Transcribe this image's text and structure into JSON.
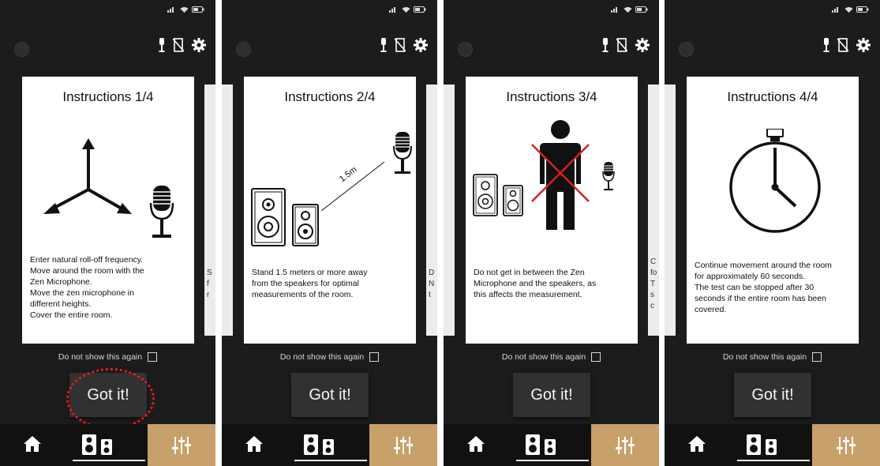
{
  "colors": {
    "accent_tab": "#c8a06a",
    "background": "#1c1c1c",
    "card": "#ffffff",
    "highlight": "#e01e1e"
  },
  "screens": [
    {
      "title": "Instructions 1/4",
      "lines": [
        "Enter natural roll-off frequency.",
        "Move around the room with the",
        "Zen Microphone.",
        "Move the zen microphone in",
        "different heights.",
        "Cover the entire room."
      ],
      "peek": [
        "S",
        "f",
        "r"
      ],
      "dont_show": "Do not show this again",
      "button": "Got it!"
    },
    {
      "title": "Instructions 2/4",
      "lines": [
        "Stand 1.5 meters or more away",
        "from the speakers for optimal",
        "measurements of the room."
      ],
      "distance_label": "1.5m",
      "peek": [
        "D",
        "N",
        "t"
      ],
      "dont_show": "Do not show this again",
      "button": "Got it!"
    },
    {
      "title": "Instructions 3/4",
      "lines": [
        "Do not get in between the Zen",
        "Microphone and the speakers, as",
        "this affects the measurement."
      ],
      "peek": [
        "C",
        "fo",
        "T",
        "s",
        "c"
      ],
      "dont_show": "Do not show this again",
      "button": "Got it!"
    },
    {
      "title": "Instructions 4/4",
      "lines": [
        "Continue movement around the room",
        "for approximately 60 seconds.",
        "The test can be stopped after 30",
        "seconds if the entire room has been",
        "covered."
      ],
      "dont_show": "Do not show this again",
      "button": "Got it!"
    }
  ],
  "icons": [
    "signal-icon",
    "wifi-icon",
    "battery-icon",
    "microphone-icon",
    "no-phone-icon",
    "gear-icon",
    "home-icon",
    "speakers-icon",
    "equalizer-icon"
  ]
}
